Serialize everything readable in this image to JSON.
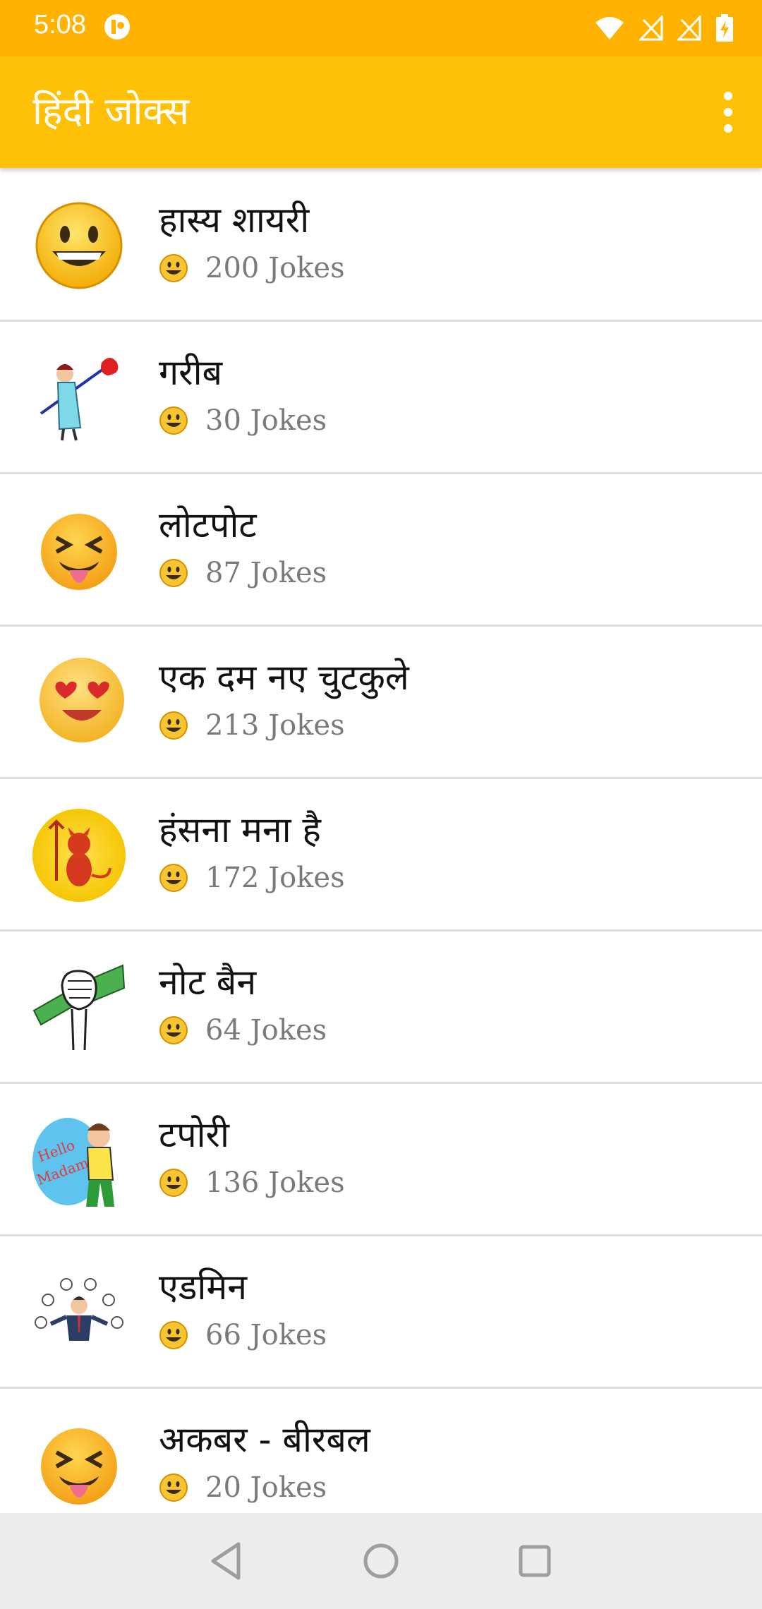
{
  "status": {
    "time": "5:08"
  },
  "app": {
    "title": "हिंदी जोक्स"
  },
  "icons": {
    "back": "back-triangle",
    "home": "home-circle",
    "recent": "recent-square",
    "more": "more-vert"
  },
  "categories": [
    {
      "title": "हास्य शायरी",
      "count": "200 Jokes",
      "icon": "smiley-face"
    },
    {
      "title": "गरीब",
      "count": "30 Jokes",
      "icon": "poor-man-cartoon"
    },
    {
      "title": "लोटपोट",
      "count": "87 Jokes",
      "icon": "laughing-squint-face"
    },
    {
      "title": "एक दम नए चुटकुले",
      "count": "213 Jokes",
      "icon": "heart-eyes-face"
    },
    {
      "title": "हंसना मना है",
      "count": "172 Jokes",
      "icon": "devil-cartoon"
    },
    {
      "title": "नोट बैन",
      "count": "64 Jokes",
      "icon": "money-fist"
    },
    {
      "title": "टपोरी",
      "count": "136 Jokes",
      "icon": "tapori-cartoon"
    },
    {
      "title": "एडमिन",
      "count": "66 Jokes",
      "icon": "admin-juggler"
    },
    {
      "title": "अकबर - बीरबल",
      "count": "20 Jokes",
      "icon": "laughing-squint-face"
    }
  ]
}
